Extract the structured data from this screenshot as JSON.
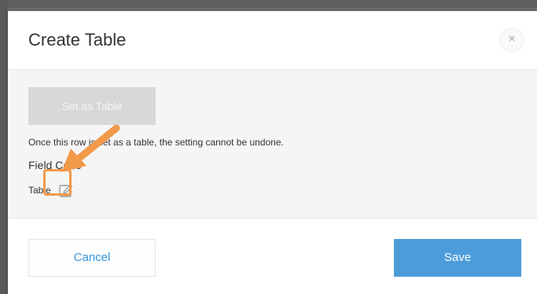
{
  "dialog": {
    "title": "Create Table",
    "close_label": "×"
  },
  "body": {
    "set_table_label": "Set as Table",
    "notice": "Once this row is set as a table, the setting cannot be undone.",
    "field_code_label": "Field Code",
    "field_code_value": "Table",
    "edit_icon": "pencil-square-icon"
  },
  "footer": {
    "cancel_label": "Cancel",
    "save_label": "Save"
  },
  "colors": {
    "accent": "#4b9cd9",
    "highlight": "#f2994a",
    "disabled_button": "#d8d8d8"
  }
}
